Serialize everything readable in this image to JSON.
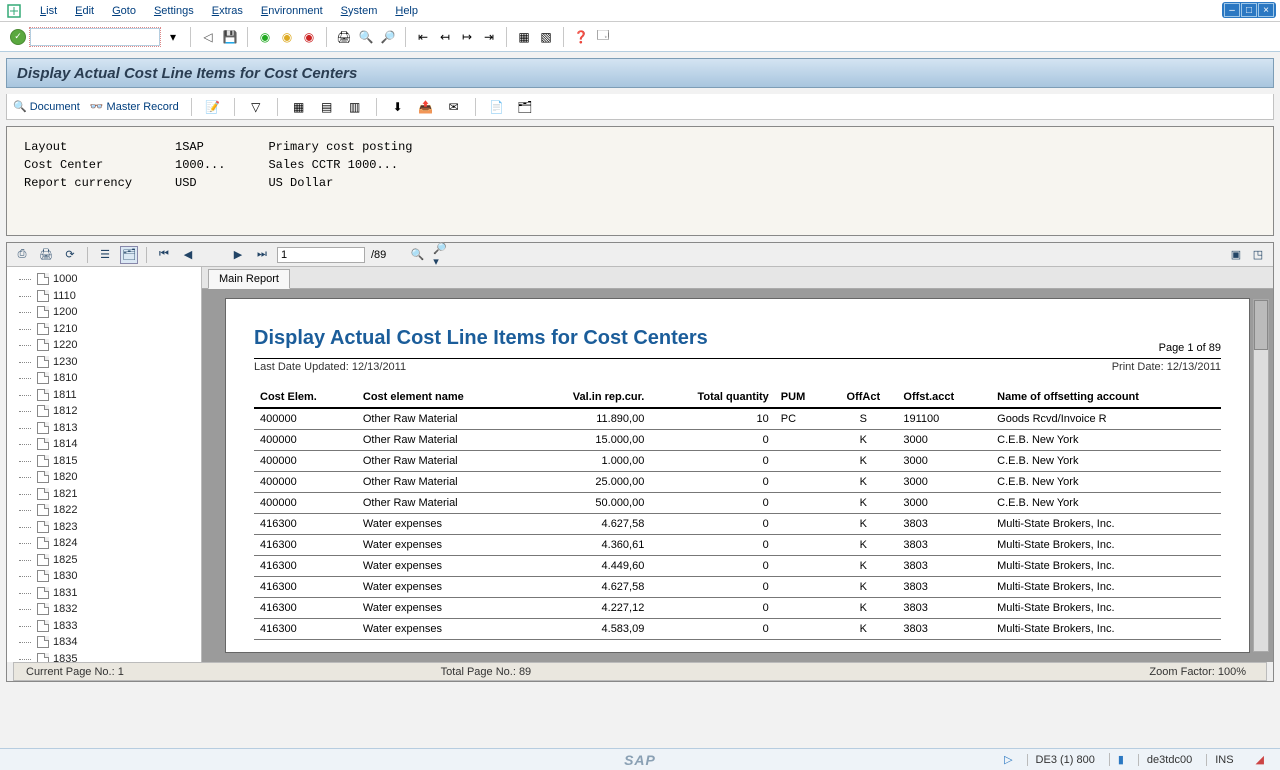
{
  "menubar": {
    "items": [
      "List",
      "Edit",
      "Goto",
      "Settings",
      "Extras",
      "Environment",
      "System",
      "Help"
    ]
  },
  "title": "Display Actual Cost Line Items for Cost Centers",
  "toolbar2": {
    "document": "Document",
    "master_record": "Master Record"
  },
  "info": {
    "rows": [
      [
        "Layout",
        "1SAP",
        "Primary cost posting"
      ],
      [
        "Cost Center",
        "1000...",
        "Sales CCTR 1000..."
      ],
      [
        "Report currency",
        "USD",
        "US Dollar"
      ]
    ]
  },
  "report_toolbar": {
    "page_current": "1",
    "page_total": "/89"
  },
  "tree_items": [
    "1000",
    "1110",
    "1200",
    "1210",
    "1220",
    "1230",
    "1810",
    "1811",
    "1812",
    "1813",
    "1814",
    "1815",
    "1820",
    "1821",
    "1822",
    "1823",
    "1824",
    "1825",
    "1830",
    "1831",
    "1832",
    "1833",
    "1834",
    "1835"
  ],
  "tabs": {
    "main": "Main Report"
  },
  "paper": {
    "title": "Display Actual Cost Line Items for Cost Centers",
    "page_label": "Page 1 of 89",
    "last_updated_label": "Last Date Updated:",
    "last_updated": "12/13/2011",
    "print_label": "Print Date:",
    "print_date": "12/13/2011",
    "headers": [
      "Cost Elem.",
      "Cost element name",
      "Val.in rep.cur.",
      "Total quantity",
      "PUM",
      "OffAct",
      "Offst.acct",
      "Name of offsetting account"
    ],
    "rows": [
      [
        "400000",
        "Other Raw Material",
        "11.890,00",
        "10",
        "PC",
        "S",
        "191100",
        "Goods Rcvd/Invoice R"
      ],
      [
        "400000",
        "Other Raw Material",
        "15.000,00",
        "0",
        "",
        "K",
        "3000",
        "C.E.B. New York"
      ],
      [
        "400000",
        "Other Raw Material",
        "1.000,00",
        "0",
        "",
        "K",
        "3000",
        "C.E.B. New York"
      ],
      [
        "400000",
        "Other Raw Material",
        "25.000,00",
        "0",
        "",
        "K",
        "3000",
        "C.E.B. New York"
      ],
      [
        "400000",
        "Other Raw Material",
        "50.000,00",
        "0",
        "",
        "K",
        "3000",
        "C.E.B. New York"
      ],
      [
        "416300",
        "Water expenses",
        "4.627,58",
        "0",
        "",
        "K",
        "3803",
        "Multi-State Brokers, Inc."
      ],
      [
        "416300",
        "Water expenses",
        "4.360,61",
        "0",
        "",
        "K",
        "3803",
        "Multi-State Brokers, Inc."
      ],
      [
        "416300",
        "Water expenses",
        "4.449,60",
        "0",
        "",
        "K",
        "3803",
        "Multi-State Brokers, Inc."
      ],
      [
        "416300",
        "Water expenses",
        "4.627,58",
        "0",
        "",
        "K",
        "3803",
        "Multi-State Brokers, Inc."
      ],
      [
        "416300",
        "Water expenses",
        "4.227,12",
        "0",
        "",
        "K",
        "3803",
        "Multi-State Brokers, Inc."
      ],
      [
        "416300",
        "Water expenses",
        "4.583,09",
        "0",
        "",
        "K",
        "3803",
        "Multi-State Brokers, Inc."
      ]
    ]
  },
  "statusbar": {
    "left": "Current Page No.: 1",
    "mid": "Total Page No.: 89",
    "right": "Zoom Factor: 100%"
  },
  "bottom": {
    "logo": "SAP",
    "sys1": "DE3 (1) 800",
    "sys2": "de3tdc00",
    "sys3": "INS"
  }
}
